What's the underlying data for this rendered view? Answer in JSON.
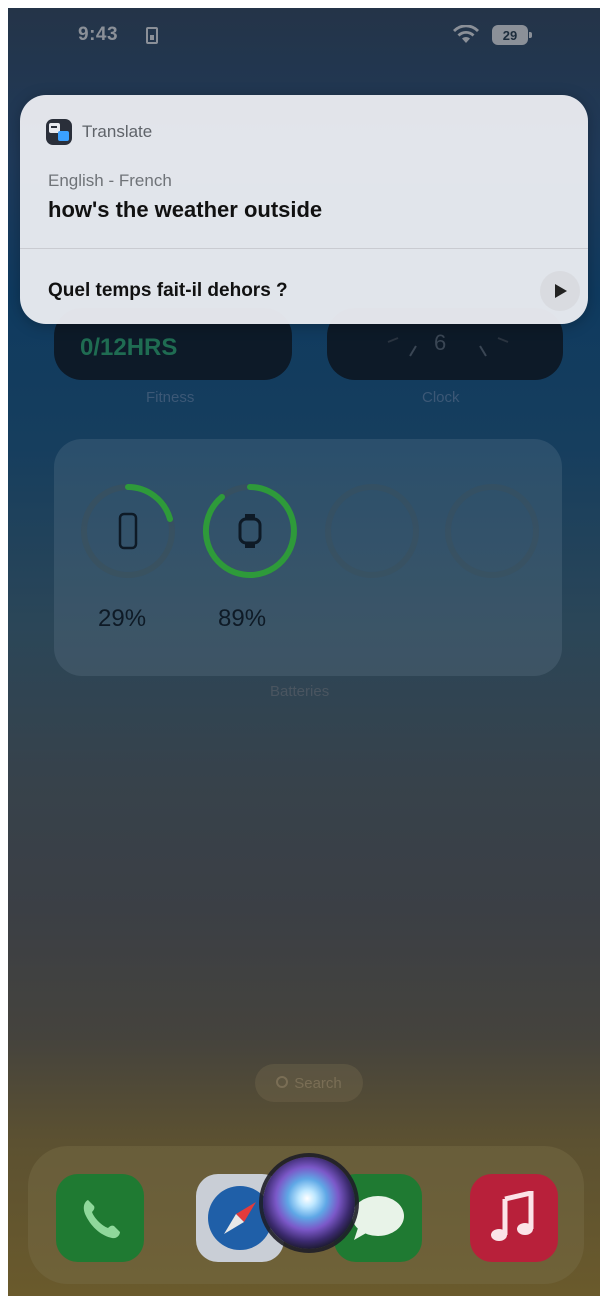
{
  "status_bar": {
    "time": "9:43",
    "battery_level": "29"
  },
  "notification": {
    "app_name": "Translate",
    "language_pair": "English - French",
    "source_text": "how's the weather outside",
    "translated_text": "Quel temps fait-il dehors ?"
  },
  "widgets": {
    "fitness": {
      "value": "0/12HRS",
      "label": "Fitness"
    },
    "clock": {
      "label": "Clock",
      "six": "6"
    },
    "batteries": {
      "label": "Batteries",
      "phone_percent": "29%",
      "watch_percent": "89%"
    }
  },
  "search": {
    "label": "Search"
  },
  "dock": {
    "apps": [
      "phone-icon",
      "safari-icon",
      "messages-icon",
      "music-icon"
    ]
  },
  "colors": {
    "card_background": "#E8EAF0",
    "fitness_accent": "#1F6C52",
    "battery_ring": "#3CB043",
    "music_red": "#C0243A",
    "phone_green": "#1F9E3A"
  }
}
